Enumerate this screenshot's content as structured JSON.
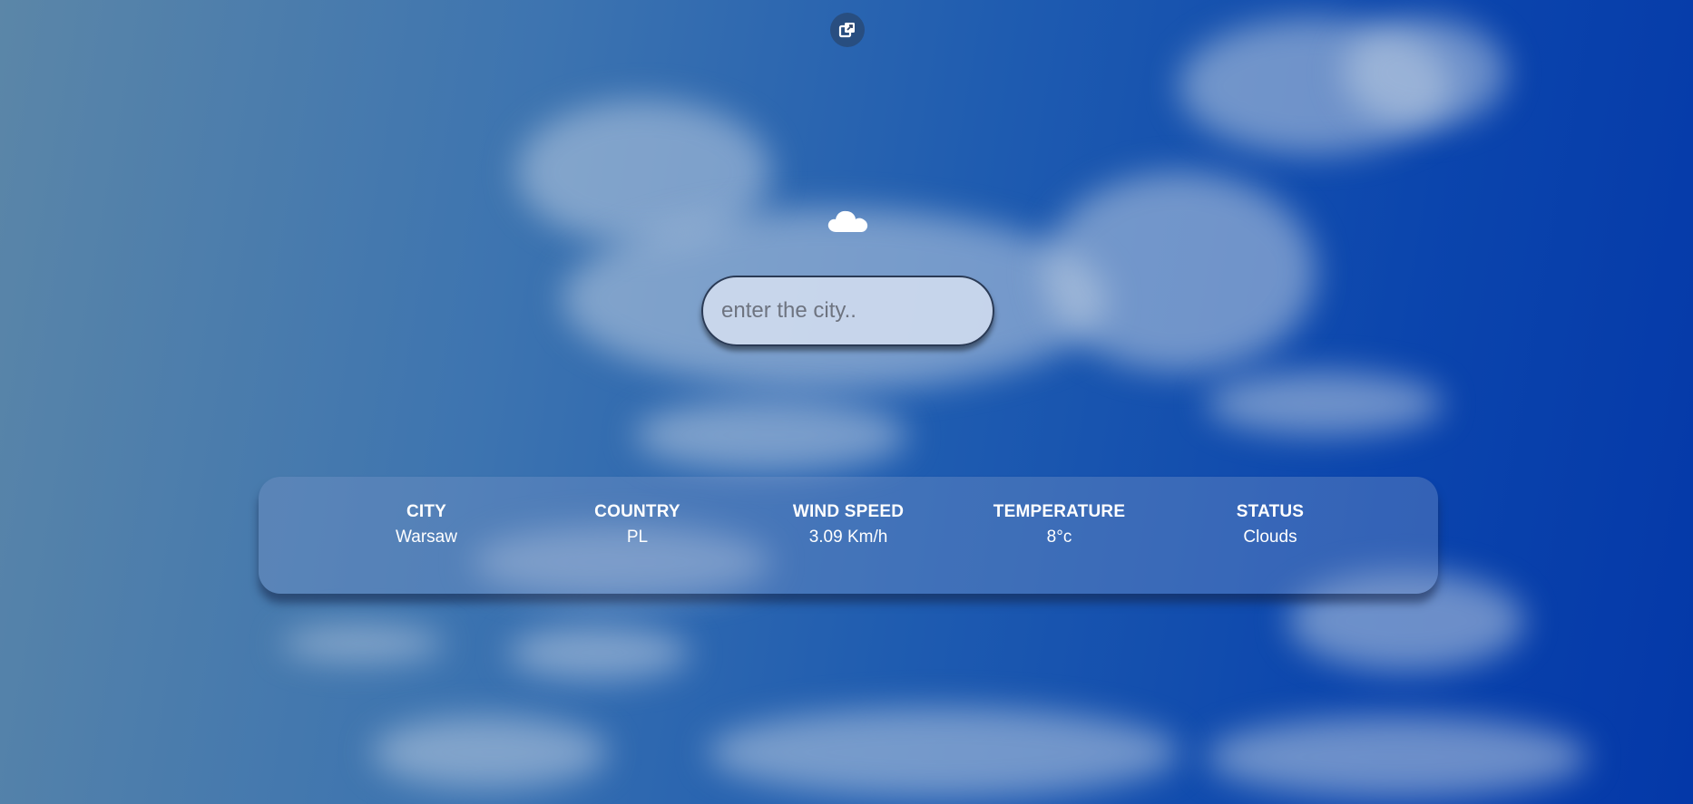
{
  "app": {
    "top_button_icon": "external-window-icon",
    "weather_icon": "cloud-icon"
  },
  "search": {
    "placeholder": "enter the city..",
    "value": ""
  },
  "weather": {
    "city": {
      "label": "CITY",
      "value": "Warsaw"
    },
    "country": {
      "label": "COUNTRY",
      "value": "PL"
    },
    "wind": {
      "label": "WIND SPEED",
      "value": "3.09 Km/h"
    },
    "temperature": {
      "label": "TEMPERATURE",
      "value": "8°c"
    },
    "status": {
      "label": "STATUS",
      "value": "Clouds"
    }
  },
  "colors": {
    "sky_light": "#5b86a8",
    "sky_dark": "#0438a8",
    "text": "#ffffff"
  }
}
